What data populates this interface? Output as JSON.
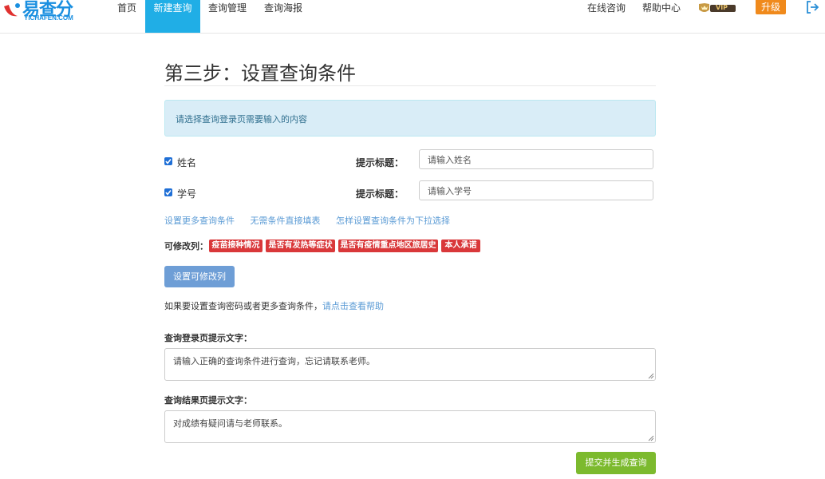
{
  "header": {
    "logo_text": "易查分",
    "logo_sub": "YICHAFEN.COM",
    "nav": [
      {
        "label": "首页",
        "active": false
      },
      {
        "label": "新建查询",
        "active": true
      },
      {
        "label": "查询管理",
        "active": false
      },
      {
        "label": "查询海报",
        "active": false
      }
    ],
    "right": {
      "online_consult": "在线咨询",
      "help_center": "帮助中心",
      "vip_badge": "VIP",
      "upgrade": "升级"
    },
    "colors": {
      "active_nav": "#20aee6",
      "upgrade": "#f08a1c"
    }
  },
  "page": {
    "title": "第三步：设置查询条件",
    "alert": "请选择查询登录页需要输入的内容",
    "conditions": [
      {
        "checked": true,
        "label": "姓名",
        "hint_label": "提示标题：",
        "placeholder": "请输入姓名"
      },
      {
        "checked": true,
        "label": "学号",
        "hint_label": "提示标题：",
        "placeholder": "请输入学号"
      }
    ],
    "links": [
      "设置更多查询条件",
      "无需条件直接填表",
      "怎样设置查询条件为下拉选择"
    ],
    "editable_label": "可修改列：",
    "editable_tags": [
      "疫苗接种情况",
      "是否有发热等症状",
      "是否有疫情重点地区旅居史",
      "本人承诺"
    ],
    "set_editable_button": "设置可修改列",
    "help_text": "如果要设置查询密码或者更多查询条件，",
    "help_link": "请点击查看帮助",
    "login_tip_label": "查询登录页提示文字：",
    "login_tip_value": "请输入正确的查询条件进行查询，忘记请联系老师。",
    "result_tip_label": "查询结果页提示文字：",
    "result_tip_value": "对成绩有疑问请与老师联系。",
    "submit_button": "提交并生成查询",
    "colors": {
      "tag": "#d9383a",
      "submit": "#7cba2e",
      "set_button": "#6e9ed6",
      "link": "#5b9bd5"
    }
  }
}
